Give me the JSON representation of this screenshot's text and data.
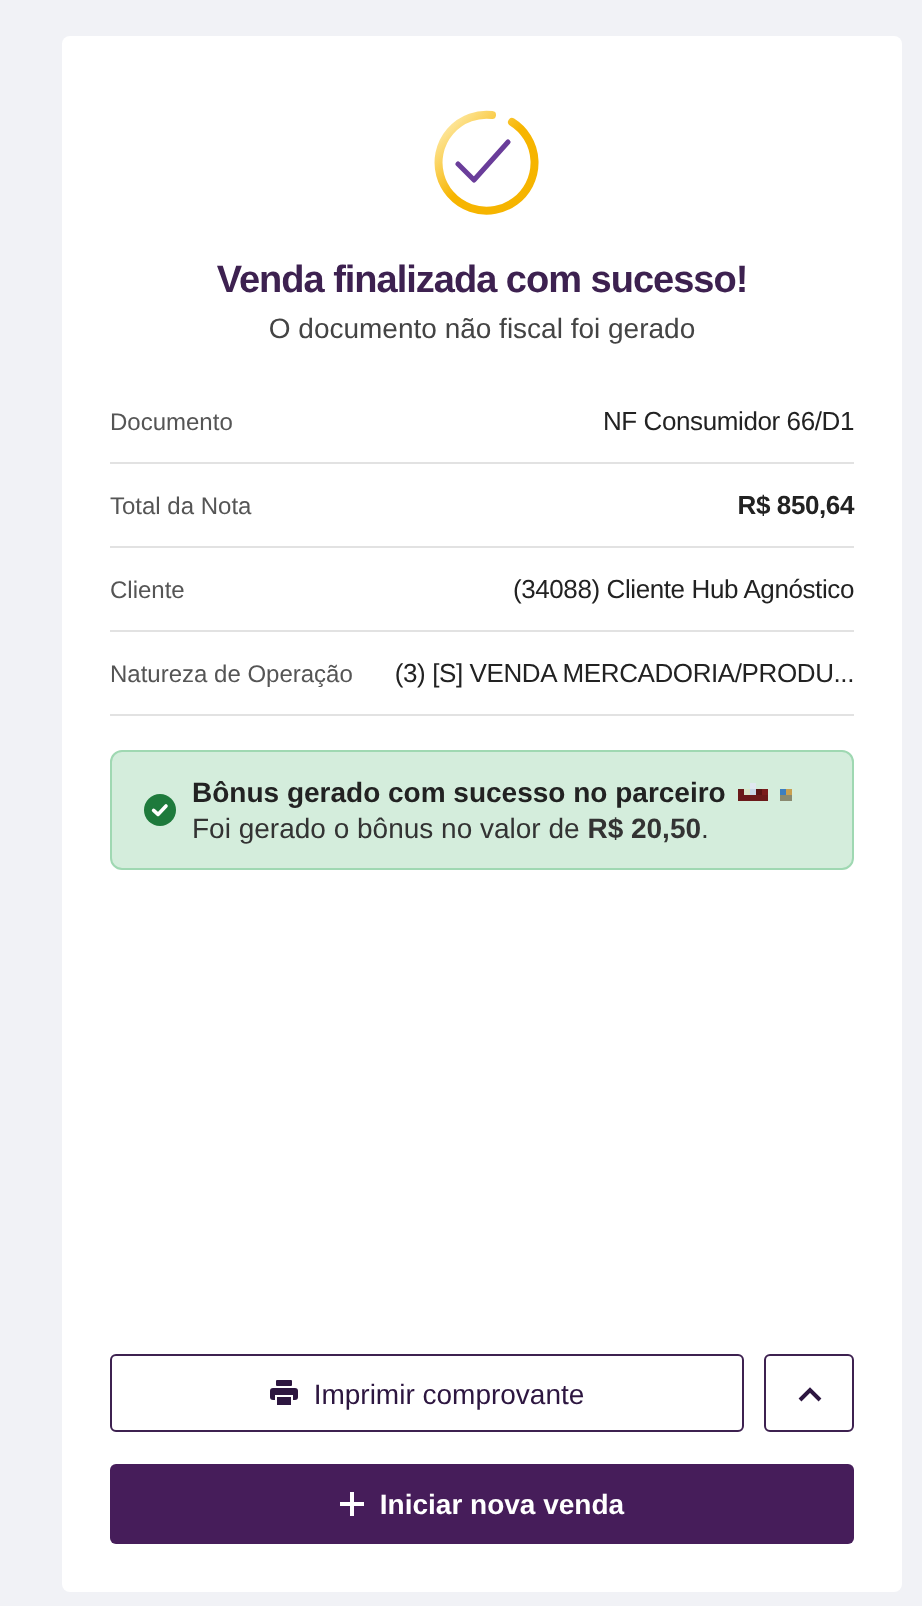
{
  "header": {
    "title": "Venda finalizada com sucesso!",
    "subtitle": "O documento não fiscal foi gerado"
  },
  "details": [
    {
      "label": "Documento",
      "value": "NF Consumidor 66/D1",
      "bold": false
    },
    {
      "label": "Total da Nota",
      "value": "R$ 850,64",
      "bold": true
    },
    {
      "label": "Cliente",
      "value": "(34088) Cliente Hub Agnóstico",
      "bold": false
    },
    {
      "label": "Natureza de Operação",
      "value": "(3) [S] VENDA MERCADORIA/PRODU...",
      "bold": false
    }
  ],
  "alert": {
    "title": "Bônus gerado com sucesso no parceiro",
    "message": "Foi gerado o bônus no valor de **R$ 20,50**."
  },
  "buttons": {
    "print": "Imprimir comprovante",
    "new_sale": "Iniciar nova venda"
  }
}
